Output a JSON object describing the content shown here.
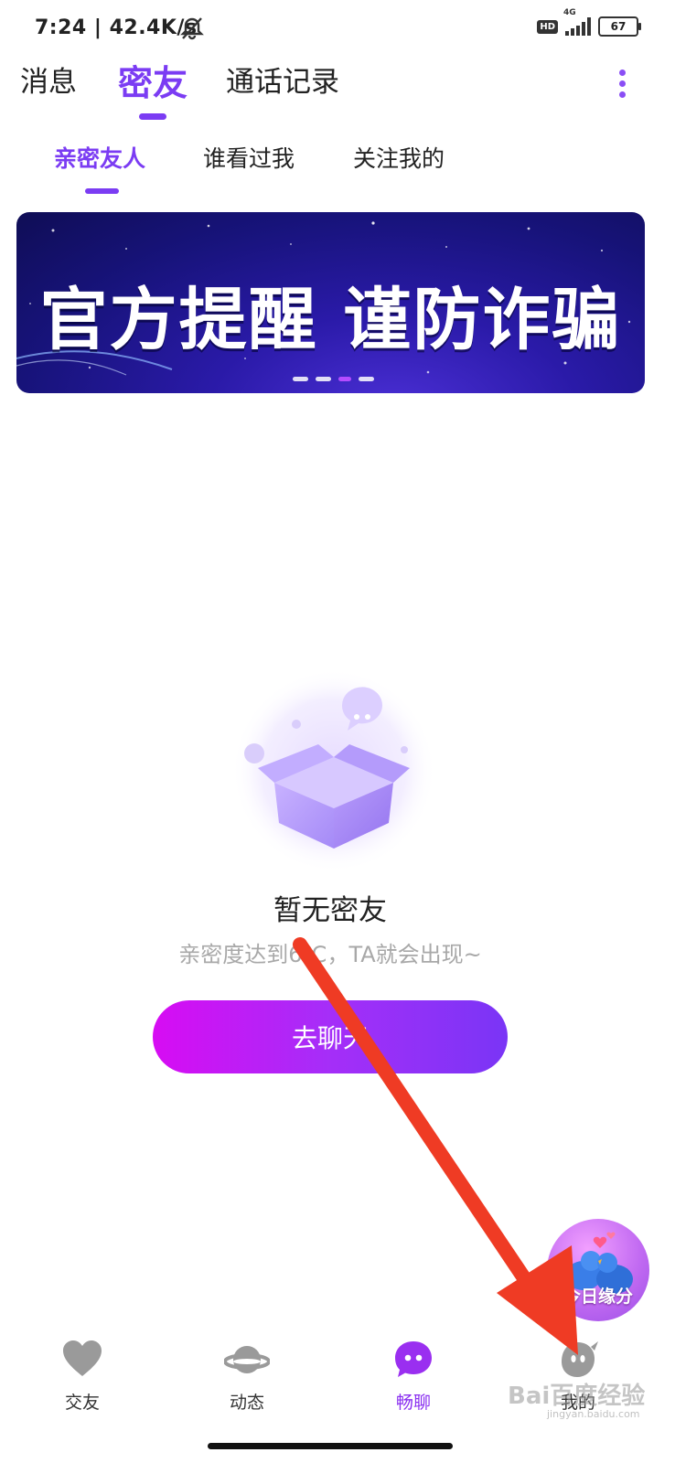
{
  "status_bar": {
    "time": "7:24 | 42.4K/s",
    "network": "4G",
    "hd": "HD",
    "battery": "67"
  },
  "top_tabs": [
    {
      "label": "消息",
      "active": false
    },
    {
      "label": "密友",
      "active": true
    },
    {
      "label": "通话记录",
      "active": false
    }
  ],
  "sub_tabs": [
    {
      "label": "亲密友人",
      "active": true
    },
    {
      "label": "谁看过我",
      "active": false
    },
    {
      "label": "关注我的",
      "active": false
    }
  ],
  "banner": {
    "text": "官方提醒 谨防诈骗",
    "slide_count": 4,
    "active_slide": 3
  },
  "empty_state": {
    "title": "暂无密友",
    "description": "亲密度达到6℃，TA就会出现~",
    "button_label": "去聊天"
  },
  "floating_badge": {
    "label": "今日缘分"
  },
  "bottom_nav": [
    {
      "label": "交友",
      "icon": "heart-icon",
      "active": false
    },
    {
      "label": "动态",
      "icon": "planet-icon",
      "active": false
    },
    {
      "label": "畅聊",
      "icon": "chat-bubble-icon",
      "active": true
    },
    {
      "label": "我的",
      "icon": "ghost-profile-icon",
      "active": false
    }
  ],
  "watermark": {
    "text": "Bai百度经验",
    "url_text": "jingyan.baidu.com"
  },
  "colors": {
    "accent": "#7b3cf3",
    "button_start": "#d70cf3",
    "button_end": "#7a35f6",
    "arrow": "#ef3b24"
  }
}
